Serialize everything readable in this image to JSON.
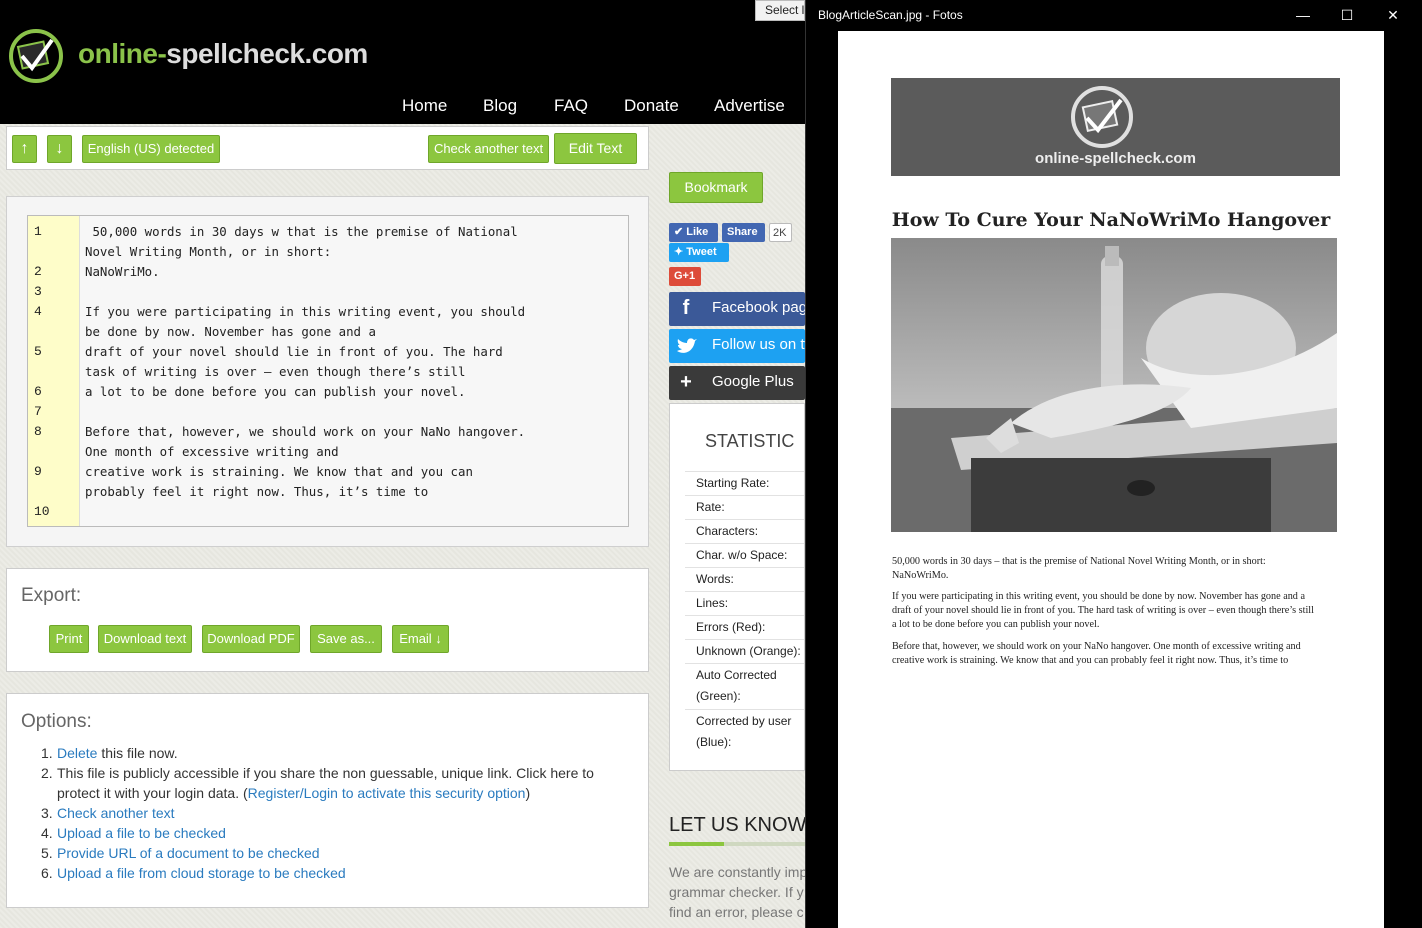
{
  "site": {
    "logo_text_a": "online-",
    "logo_text_b": "spellcheck.com",
    "nav": [
      "Home",
      "Blog",
      "FAQ",
      "Donate",
      "Advertise"
    ],
    "select_tooltip": "Select l"
  },
  "toolbar": {
    "up_label": "↑",
    "down_label": "↓",
    "language": "English (US) detected",
    "check_another": "Check another text",
    "edit_text": "Edit Text"
  },
  "editor": {
    "line_numbers": [
      "1",
      "2",
      "3",
      "4",
      "5",
      "6",
      "7",
      "8",
      "9",
      "10"
    ],
    "lines": [
      " 50,000 words in 30 days w that is the premise of National",
      "Novel Writing Month, or in short:",
      "NaNoWriMo.",
      "",
      "If you were participating in this writing event, you should",
      "be done by now. November has gone and a",
      "draft of your novel should lie in front of you. The hard",
      "task of writing is over — even though there’s still",
      "a lot to be done before you can publish your novel.",
      "",
      "Before that, however, we should work on your NaNo hangover.",
      "One month of excessive writing and",
      "creative work is straining. We know that and you can",
      "probably feel it right now. Thus, it’s time to"
    ]
  },
  "export": {
    "title": "Export:",
    "buttons": [
      "Print",
      "Download text",
      "Download PDF",
      "Save as...",
      "Email ↓"
    ]
  },
  "options": {
    "title": "Options:",
    "items": [
      {
        "num": "1.",
        "link": "Delete",
        "text": " this file now."
      },
      {
        "num": "2.",
        "text_a": "This file is publicly accessible if you share the non guessable, unique link. Click here to",
        "text_b": "protect it with your login data. (",
        "link": "Register/Login to activate this security option",
        "text_c": ")"
      },
      {
        "num": "3.",
        "link": "Check another text"
      },
      {
        "num": "4.",
        "link": "Upload a file to be checked"
      },
      {
        "num": "5.",
        "link": "Provide URL of a document to be checked"
      },
      {
        "num": "6.",
        "link": "Upload a file from cloud storage to be checked"
      }
    ]
  },
  "side": {
    "bookmark": "Bookmark",
    "like": "Like",
    "share": "Share",
    "share_count": "2K",
    "tweet": "Tweet",
    "gplus_small": "G+1",
    "facebook": "Facebook page",
    "twitter": "Follow us on twitter",
    "googleplus": "Google Plus",
    "statistic_title": "STATISTIC",
    "stats": [
      "Starting Rate:",
      "Rate:",
      "Characters:",
      "Char. w/o Space:",
      "Words:",
      "Lines:",
      "Errors (Red):",
      "Unknown (Orange):",
      "Auto Corrected",
      "(Green):",
      "Corrected by user",
      "(Blue):"
    ],
    "letus_title": "LET US KNOW",
    "letus_lines": [
      "We are constantly imp",
      "grammar checker. If y",
      "find an error, please c"
    ]
  },
  "photos": {
    "window_title": "BlogArticleScan.jpg - Fotos",
    "min": "—",
    "max": "☐",
    "close": "✕",
    "scan_logo_text": "online-spellcheck.com",
    "scan_title": "How To Cure Your NaNoWriMo Hangover",
    "scan_p1": [
      "50,000 words in 30 days – that is the premise of National Novel Writing Month, or in short:",
      "NaNoWriMo."
    ],
    "scan_p2": [
      "If you were participating in this writing event, you should be done by now. November has gone and a",
      "draft of your novel should lie in front of you. The hard task of writing is over – even though there’s still",
      "a lot to be done before you can publish your novel."
    ],
    "scan_p3": [
      "Before that, however, we should work on your NaNo hangover. One month of excessive writing and",
      "creative work is straining. We know that and you can probably feel it right now. Thus, it’s time to"
    ]
  },
  "colors": {
    "accent_green": "#8cc63f",
    "link_blue": "#2a7bbf",
    "facebook": "#3b5998",
    "twitter": "#1da1f2"
  }
}
